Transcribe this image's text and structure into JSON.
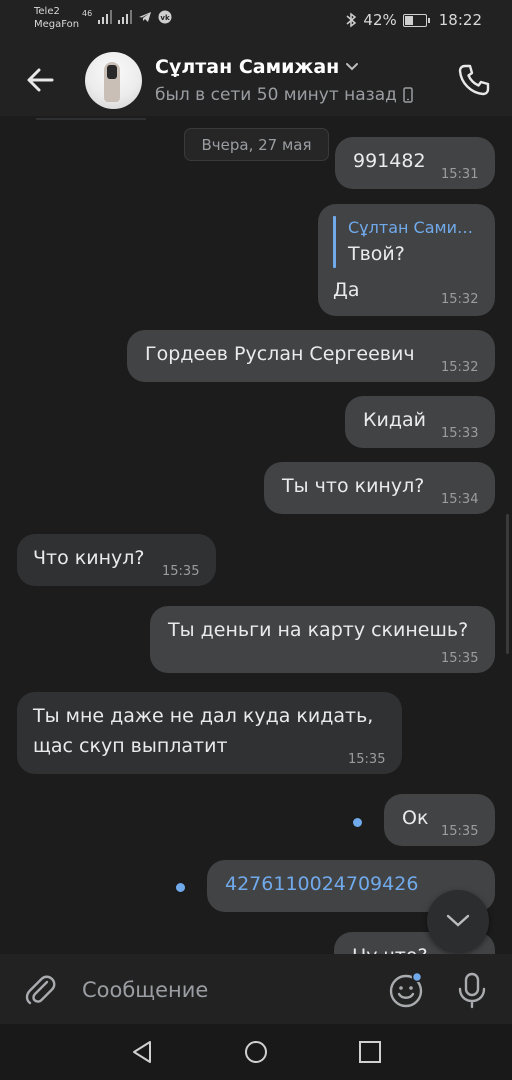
{
  "status_bar": {
    "carrier1": "Tele2",
    "carrier2": "MegaFon",
    "signal_label": "46",
    "battery": "42%",
    "battery_level": 0.42,
    "time": "18:22"
  },
  "header": {
    "name": "Сұлтан Самижан",
    "status": "был в сети 50 минут назад"
  },
  "chat": {
    "date_separator": "Вчера, 27 мая",
    "messages": [
      {
        "dir": "out",
        "text": "991482",
        "time": "15:31"
      },
      {
        "dir": "out",
        "reply_to": "Сұлтан Сами…",
        "reply_text": "Твой?",
        "text": "Да",
        "time": "15:32"
      },
      {
        "dir": "out",
        "text": "Гордеев Руслан Сергеевич",
        "time": "15:32"
      },
      {
        "dir": "out",
        "text": "Кидай",
        "time": "15:33"
      },
      {
        "dir": "out",
        "text": "Ты что кинул?",
        "time": "15:34"
      },
      {
        "dir": "in",
        "text": "Что кинул?",
        "time": "15:35"
      },
      {
        "dir": "out",
        "text": "Ты деньги на карту скинешь?",
        "time": "15:35"
      },
      {
        "dir": "in",
        "text_line1": "Ты мне даже не дал куда кидать,",
        "text_line2": "щас скуп выплатит",
        "time": "15:35"
      },
      {
        "dir": "out",
        "text": "Ок",
        "time": "15:35",
        "unread": true
      },
      {
        "dir": "out",
        "text": "4276110024709426",
        "link": true,
        "unread": true
      },
      {
        "dir": "out",
        "text": "Ну что?",
        "partial": true
      }
    ]
  },
  "composer": {
    "placeholder": "Сообщение"
  },
  "colors": {
    "background": "#1c1c1c",
    "bubble_out": "#424345",
    "bubble_in": "#303133",
    "accent": "#71aaeb"
  },
  "icons": {
    "back": "arrow-left-icon",
    "dropdown": "chevron-down-icon",
    "device": "phone-device-icon",
    "call": "phone-call-icon",
    "scroll_down": "chevron-down-icon",
    "attach": "paperclip-icon",
    "emoji": "smile-icon",
    "mic": "microphone-icon"
  }
}
